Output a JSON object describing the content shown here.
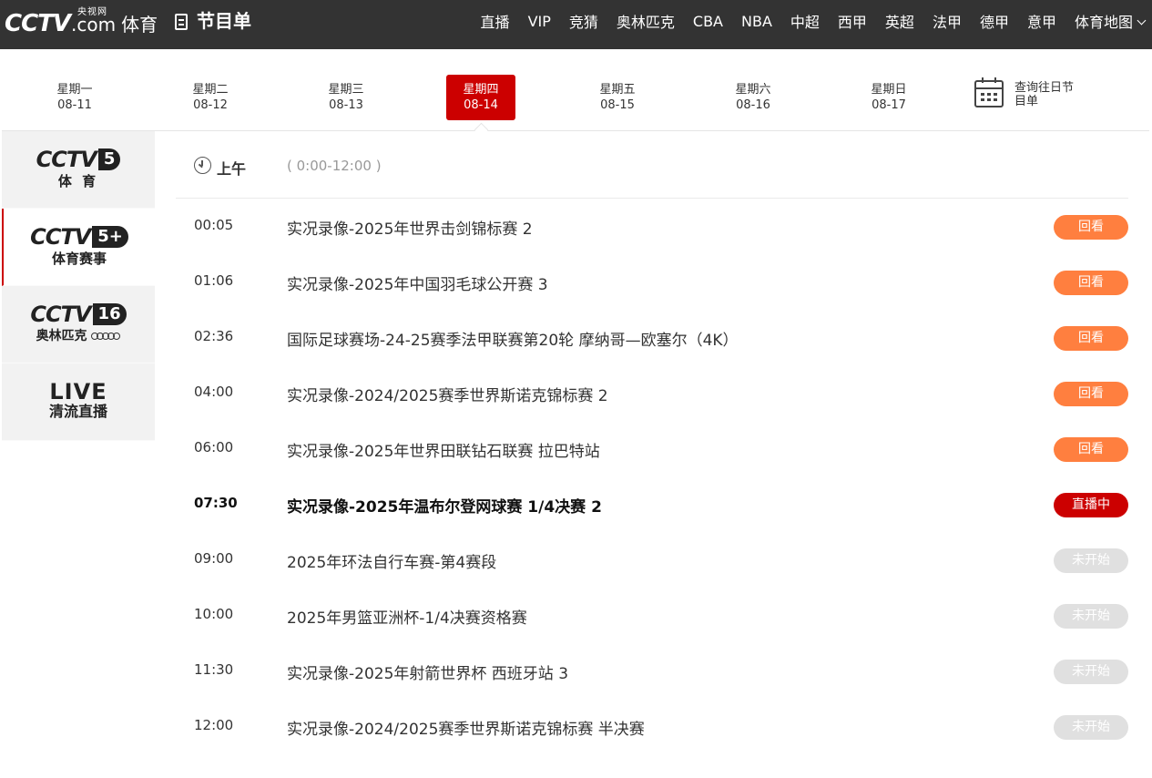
{
  "header": {
    "logo_cctv": "CCTV",
    "logo_com": ".com",
    "logo_yangshi": "央视网",
    "logo_sports": "体育",
    "page_title": "节目单",
    "nav": [
      "直播",
      "VIP",
      "竞猜",
      "奥林匹克",
      "CBA",
      "NBA",
      "中超",
      "西甲",
      "英超",
      "法甲",
      "德甲",
      "意甲",
      "体育地图"
    ]
  },
  "dates": [
    {
      "weekday": "星期一",
      "date": "08-11"
    },
    {
      "weekday": "星期二",
      "date": "08-12"
    },
    {
      "weekday": "星期三",
      "date": "08-13"
    },
    {
      "weekday": "星期四",
      "date": "08-14",
      "active": true
    },
    {
      "weekday": "星期五",
      "date": "08-15"
    },
    {
      "weekday": "星期六",
      "date": "08-16"
    },
    {
      "weekday": "星期日",
      "date": "08-17"
    }
  ],
  "history": {
    "label": "查询往日节目单"
  },
  "channels": [
    {
      "cctv": "CCTV",
      "badge": "5",
      "sub": "体 育"
    },
    {
      "cctv": "CCTV",
      "badge": "5+",
      "sub": "体育赛事"
    },
    {
      "cctv": "CCTV",
      "badge": "16",
      "sub": "奥林匹克"
    },
    {
      "live": "LIVE",
      "sub": "清流直播"
    }
  ],
  "schedule": {
    "period": "上午",
    "range": "( 0:00-12:00 )",
    "status_labels": {
      "replay": "回看",
      "live": "直播中",
      "pending": "未开始"
    },
    "colors": {
      "replay": "#ff7f3f",
      "live": "#cc0000",
      "pending": "#e0e0e0"
    },
    "items": [
      {
        "time": "00:05",
        "title": "实况录像-2025年世界击剑锦标赛 2",
        "status": "回看"
      },
      {
        "time": "01:06",
        "title": "实况录像-2025年中国羽毛球公开赛 3",
        "status": "回看"
      },
      {
        "time": "02:36",
        "title": "国际足球赛场-24-25赛季法甲联赛第20轮 摩纳哥—欧塞尔（4K）",
        "status": "回看"
      },
      {
        "time": "04:00",
        "title": "实况录像-2024/2025赛季世界斯诺克锦标赛 2",
        "status": "回看"
      },
      {
        "time": "06:00",
        "title": "实况录像-2025年世界田联钻石联赛 拉巴特站",
        "status": "回看"
      },
      {
        "time": "07:30",
        "title": "实况录像-2025年温布尔登网球赛 1/4决赛 2",
        "status": "直播中"
      },
      {
        "time": "09:00",
        "title": "2025年环法自行车赛-第4赛段",
        "status": "未开始"
      },
      {
        "time": "10:00",
        "title": "2025年男篮亚洲杯-1/4决赛资格赛",
        "status": "未开始"
      },
      {
        "time": "11:30",
        "title": "实况录像-2025年射箭世界杯 西班牙站 3",
        "status": "未开始"
      },
      {
        "time": "12:00",
        "title": "实况录像-2024/2025赛季世界斯诺克锦标赛 半决赛",
        "status": "未开始"
      }
    ]
  }
}
